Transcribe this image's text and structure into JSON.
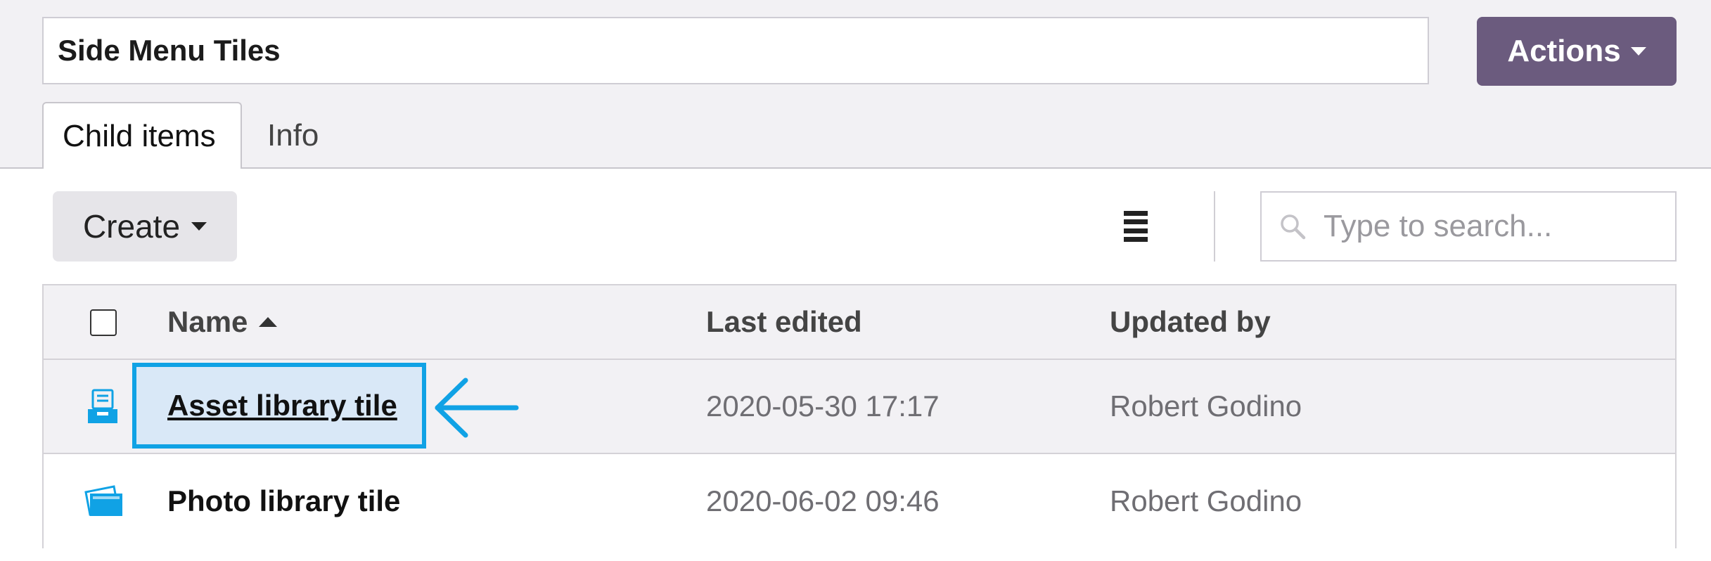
{
  "header": {
    "title_value": "Side Menu Tiles",
    "actions_label": "Actions"
  },
  "tabs": [
    {
      "label": "Child items",
      "active": true
    },
    {
      "label": "Info",
      "active": false
    }
  ],
  "toolbar": {
    "create_label": "Create",
    "search_placeholder": "Type to search..."
  },
  "table": {
    "columns": [
      "Name",
      "Last edited",
      "Updated by"
    ],
    "sort": {
      "column": "Name",
      "direction": "ascending"
    },
    "rows": [
      {
        "name": "Asset library tile",
        "last_edited": "2020-05-30 17:17",
        "updated_by": "Robert Godino",
        "icon": "asset-library-icon",
        "highlighted": true
      },
      {
        "name": "Photo library tile",
        "last_edited": "2020-06-02 09:46",
        "updated_by": "Robert Godino",
        "icon": "photo-library-icon",
        "highlighted": false
      }
    ]
  },
  "colors": {
    "accent": "#10a2e5",
    "actions_bg": "#6b5b7e",
    "highlight_bg": "#d9e8f7"
  }
}
